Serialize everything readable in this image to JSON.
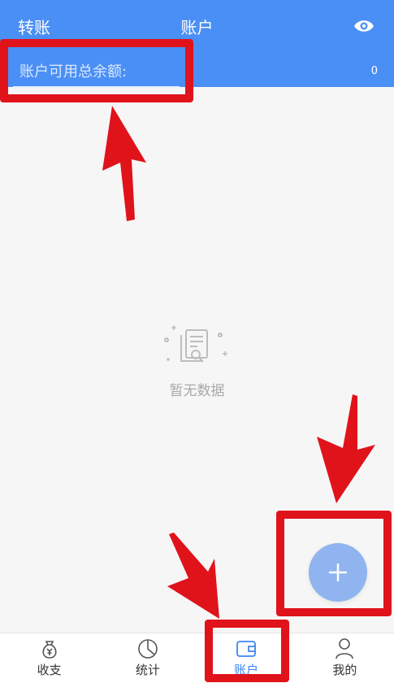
{
  "header": {
    "left_action": "转账",
    "title": "账户",
    "eye_icon": "eye-icon",
    "balance_label": "账户可用总余额:",
    "balance_value": "0",
    "color": "#4a8ff5"
  },
  "empty_state": {
    "icon": "document-search-icon",
    "text": "暂无数据"
  },
  "fab": {
    "icon": "plus-icon",
    "color": "#8fb4ef"
  },
  "tabbar": {
    "items": [
      {
        "label": "收支",
        "icon": "money-bag-icon"
      },
      {
        "label": "统计",
        "icon": "pie-chart-icon"
      },
      {
        "label": "账户",
        "icon": "wallet-icon",
        "active": true
      },
      {
        "label": "我的",
        "icon": "user-icon"
      }
    ],
    "active_color": "#3b86f0"
  },
  "annotation_color": "#e0131b"
}
